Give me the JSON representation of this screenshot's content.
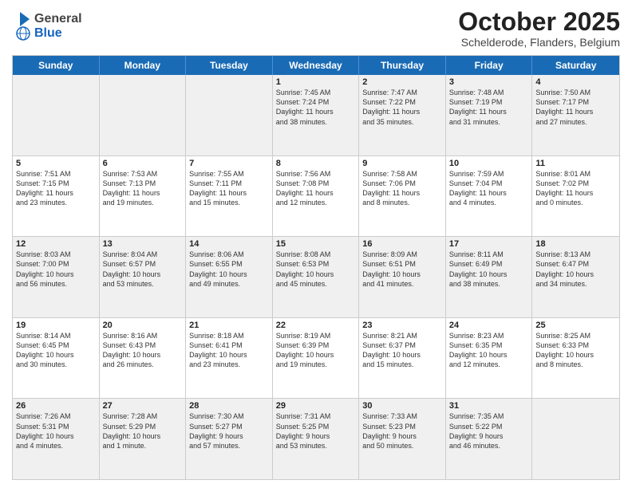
{
  "header": {
    "logo_general": "General",
    "logo_blue": "Blue",
    "month": "October 2025",
    "location": "Schelderode, Flanders, Belgium"
  },
  "weekdays": [
    "Sunday",
    "Monday",
    "Tuesday",
    "Wednesday",
    "Thursday",
    "Friday",
    "Saturday"
  ],
  "rows": [
    [
      {
        "day": "",
        "info": ""
      },
      {
        "day": "",
        "info": ""
      },
      {
        "day": "",
        "info": ""
      },
      {
        "day": "1",
        "info": "Sunrise: 7:45 AM\nSunset: 7:24 PM\nDaylight: 11 hours\nand 38 minutes."
      },
      {
        "day": "2",
        "info": "Sunrise: 7:47 AM\nSunset: 7:22 PM\nDaylight: 11 hours\nand 35 minutes."
      },
      {
        "day": "3",
        "info": "Sunrise: 7:48 AM\nSunset: 7:19 PM\nDaylight: 11 hours\nand 31 minutes."
      },
      {
        "day": "4",
        "info": "Sunrise: 7:50 AM\nSunset: 7:17 PM\nDaylight: 11 hours\nand 27 minutes."
      }
    ],
    [
      {
        "day": "5",
        "info": "Sunrise: 7:51 AM\nSunset: 7:15 PM\nDaylight: 11 hours\nand 23 minutes."
      },
      {
        "day": "6",
        "info": "Sunrise: 7:53 AM\nSunset: 7:13 PM\nDaylight: 11 hours\nand 19 minutes."
      },
      {
        "day": "7",
        "info": "Sunrise: 7:55 AM\nSunset: 7:11 PM\nDaylight: 11 hours\nand 15 minutes."
      },
      {
        "day": "8",
        "info": "Sunrise: 7:56 AM\nSunset: 7:08 PM\nDaylight: 11 hours\nand 12 minutes."
      },
      {
        "day": "9",
        "info": "Sunrise: 7:58 AM\nSunset: 7:06 PM\nDaylight: 11 hours\nand 8 minutes."
      },
      {
        "day": "10",
        "info": "Sunrise: 7:59 AM\nSunset: 7:04 PM\nDaylight: 11 hours\nand 4 minutes."
      },
      {
        "day": "11",
        "info": "Sunrise: 8:01 AM\nSunset: 7:02 PM\nDaylight: 11 hours\nand 0 minutes."
      }
    ],
    [
      {
        "day": "12",
        "info": "Sunrise: 8:03 AM\nSunset: 7:00 PM\nDaylight: 10 hours\nand 56 minutes."
      },
      {
        "day": "13",
        "info": "Sunrise: 8:04 AM\nSunset: 6:57 PM\nDaylight: 10 hours\nand 53 minutes."
      },
      {
        "day": "14",
        "info": "Sunrise: 8:06 AM\nSunset: 6:55 PM\nDaylight: 10 hours\nand 49 minutes."
      },
      {
        "day": "15",
        "info": "Sunrise: 8:08 AM\nSunset: 6:53 PM\nDaylight: 10 hours\nand 45 minutes."
      },
      {
        "day": "16",
        "info": "Sunrise: 8:09 AM\nSunset: 6:51 PM\nDaylight: 10 hours\nand 41 minutes."
      },
      {
        "day": "17",
        "info": "Sunrise: 8:11 AM\nSunset: 6:49 PM\nDaylight: 10 hours\nand 38 minutes."
      },
      {
        "day": "18",
        "info": "Sunrise: 8:13 AM\nSunset: 6:47 PM\nDaylight: 10 hours\nand 34 minutes."
      }
    ],
    [
      {
        "day": "19",
        "info": "Sunrise: 8:14 AM\nSunset: 6:45 PM\nDaylight: 10 hours\nand 30 minutes."
      },
      {
        "day": "20",
        "info": "Sunrise: 8:16 AM\nSunset: 6:43 PM\nDaylight: 10 hours\nand 26 minutes."
      },
      {
        "day": "21",
        "info": "Sunrise: 8:18 AM\nSunset: 6:41 PM\nDaylight: 10 hours\nand 23 minutes."
      },
      {
        "day": "22",
        "info": "Sunrise: 8:19 AM\nSunset: 6:39 PM\nDaylight: 10 hours\nand 19 minutes."
      },
      {
        "day": "23",
        "info": "Sunrise: 8:21 AM\nSunset: 6:37 PM\nDaylight: 10 hours\nand 15 minutes."
      },
      {
        "day": "24",
        "info": "Sunrise: 8:23 AM\nSunset: 6:35 PM\nDaylight: 10 hours\nand 12 minutes."
      },
      {
        "day": "25",
        "info": "Sunrise: 8:25 AM\nSunset: 6:33 PM\nDaylight: 10 hours\nand 8 minutes."
      }
    ],
    [
      {
        "day": "26",
        "info": "Sunrise: 7:26 AM\nSunset: 5:31 PM\nDaylight: 10 hours\nand 4 minutes."
      },
      {
        "day": "27",
        "info": "Sunrise: 7:28 AM\nSunset: 5:29 PM\nDaylight: 10 hours\nand 1 minute."
      },
      {
        "day": "28",
        "info": "Sunrise: 7:30 AM\nSunset: 5:27 PM\nDaylight: 9 hours\nand 57 minutes."
      },
      {
        "day": "29",
        "info": "Sunrise: 7:31 AM\nSunset: 5:25 PM\nDaylight: 9 hours\nand 53 minutes."
      },
      {
        "day": "30",
        "info": "Sunrise: 7:33 AM\nSunset: 5:23 PM\nDaylight: 9 hours\nand 50 minutes."
      },
      {
        "day": "31",
        "info": "Sunrise: 7:35 AM\nSunset: 5:22 PM\nDaylight: 9 hours\nand 46 minutes."
      },
      {
        "day": "",
        "info": ""
      }
    ]
  ],
  "alt_rows": [
    0,
    2,
    4
  ]
}
